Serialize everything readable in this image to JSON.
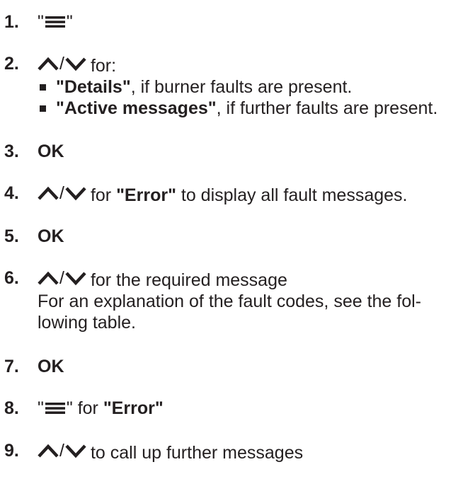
{
  "steps": [
    {
      "num": "1."
    },
    {
      "num": "2.",
      "text": "for:",
      "bullets": [
        {
          "bold": "\"Details\"",
          "rest": ", if burner faults are present."
        },
        {
          "bold": "\"Active messages\"",
          "rest": ", if further faults are present."
        }
      ]
    },
    {
      "num": "3.",
      "text": "OK"
    },
    {
      "num": "4.",
      "pre": "for ",
      "bold": "\"Error\"",
      "post": " to display all fault messages."
    },
    {
      "num": "5.",
      "text": "OK"
    },
    {
      "num": "6.",
      "text": "for the required message",
      "line2": "For an explanation of the fault codes, see the fol-",
      "line3": "lowing table."
    },
    {
      "num": "7.",
      "text": "OK"
    },
    {
      "num": "8.",
      "pre": " for ",
      "bold": "\"Error\""
    },
    {
      "num": "9.",
      "text": "to call up further messages"
    }
  ],
  "icons": {
    "menu": "menu-icon",
    "up": "arrow-up-icon",
    "down": "arrow-down-icon"
  },
  "quote_open": "\"",
  "quote_close": "\"",
  "slash": "/"
}
